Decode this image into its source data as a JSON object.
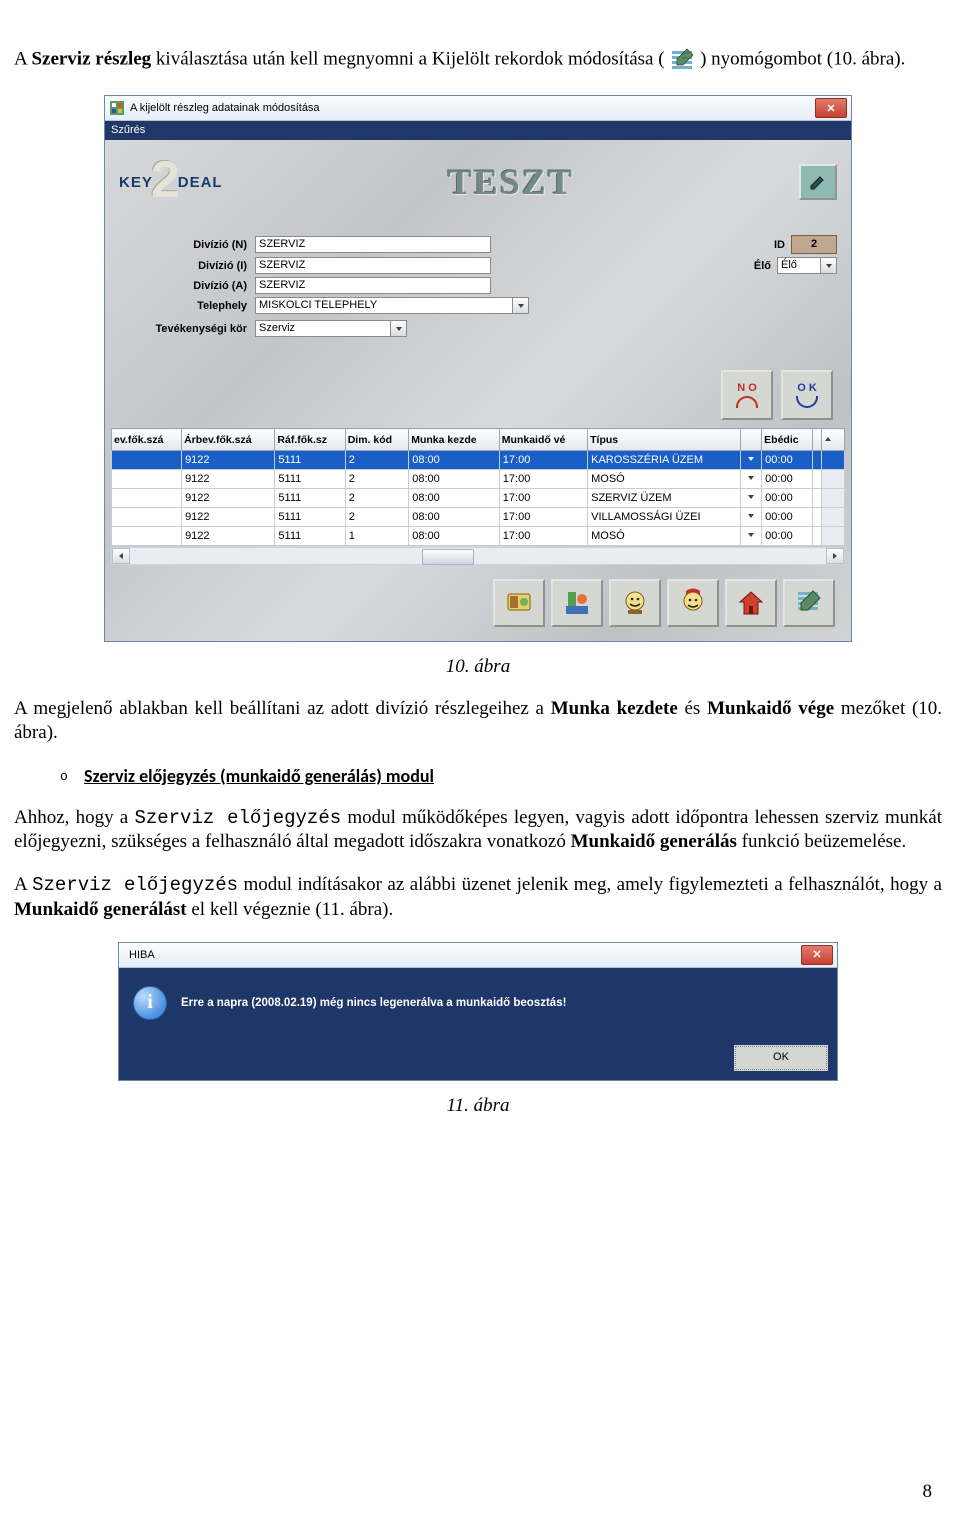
{
  "intro": {
    "t1": "A ",
    "t2_b": "Szerviz részleg",
    "t3": " kiválasztása után kell megnyomni a Kijelölt rekordok módosítása ( ",
    "t4": " ) nyomógombot (10. ábra)."
  },
  "win": {
    "title": "A kijelölt részleg adatainak módosítása",
    "menu": "Szűrés",
    "logo_key": "KEY",
    "logo_deal": "DEAL",
    "teszt": "TESZT",
    "fields": {
      "div_n_lab": "Divízió (N)",
      "div_n_val": "SZERVIZ",
      "id_lab": "ID",
      "id_val": "2",
      "div_i_lab": "Divízió (I)",
      "div_i_val": "SZERVIZ",
      "elo_lab": "Élő",
      "elo_val": "Élő",
      "div_a_lab": "Divízió (A)",
      "div_a_val": "SZERVIZ",
      "site_lab": "Telephely",
      "site_val": "MISKOLCI TELEPHELY",
      "tev_lab": "Tevékenységi kör",
      "tev_val": "Szerviz"
    },
    "no_label": "N O",
    "ok_label": "O K",
    "grid": {
      "headers": [
        "ev.fők.szá",
        "Árbev.fők.szá",
        "Ráf.fők.sz",
        "Dim. kód",
        "Munka kezde",
        "Munkaidő vé",
        "Típus",
        "",
        "Ebédic",
        ""
      ],
      "rows": [
        {
          "c": [
            "",
            "9122",
            "5111",
            "2",
            "08:00",
            "17:00",
            "KAROSSZÉRIA ÜZEM",
            "▼",
            "00:00",
            ""
          ],
          "sel": true
        },
        {
          "c": [
            "",
            "9122",
            "5111",
            "2",
            "08:00",
            "17:00",
            "MOSÓ",
            "▼",
            "00:00",
            ""
          ]
        },
        {
          "c": [
            "",
            "9122",
            "5111",
            "2",
            "08:00",
            "17:00",
            "SZERVIZ ÜZEM",
            "▼",
            "00:00",
            ""
          ]
        },
        {
          "c": [
            "",
            "9122",
            "5111",
            "2",
            "08:00",
            "17:00",
            "VILLAMOSSÁGI ÜZEI",
            "▼",
            "00:00",
            ""
          ]
        },
        {
          "c": [
            "",
            "9122",
            "5111",
            "1",
            "08:00",
            "17:00",
            "MOSÓ",
            "▼",
            "00:00",
            ""
          ]
        }
      ]
    }
  },
  "cap10": "10. ábra",
  "para1": {
    "a": "A megjelenő ablakban kell beállítani az adott divízió részlegeihez a ",
    "b": "Munka kezdete",
    "c": " és ",
    "d": "Munkaidő vége",
    "e": " mezőket (10. ábra)."
  },
  "bullet": {
    "head": "Szerviz előjegyzés (munkaidő generálás) modul"
  },
  "para2": {
    "a": "Ahhoz, hogy a ",
    "b": "Szerviz előjegyzés",
    "c": " modul működőképes legyen, vagyis adott időpontra lehessen szerviz munkát előjegyezni, szükséges a felhasználó által megadott időszakra vonatkozó ",
    "d": "Munkaidő generálás",
    "e": " funkció beüzemelése."
  },
  "para3": {
    "a": "A ",
    "b": "Szerviz előjegyzés",
    "c": " modul indításakor az alábbi üzenet jelenik meg, amely figylemezteti a felhasználót, hogy a ",
    "d": "Munkaidő generálást",
    "e": " el kell végeznie (11. ábra)."
  },
  "msgbox": {
    "title": "HIBA",
    "text": "Erre a napra (2008.02.19) még nincs legenerálva a munkaidő beosztás!",
    "ok": "OK"
  },
  "cap11": "11. ábra",
  "page_num": "8"
}
